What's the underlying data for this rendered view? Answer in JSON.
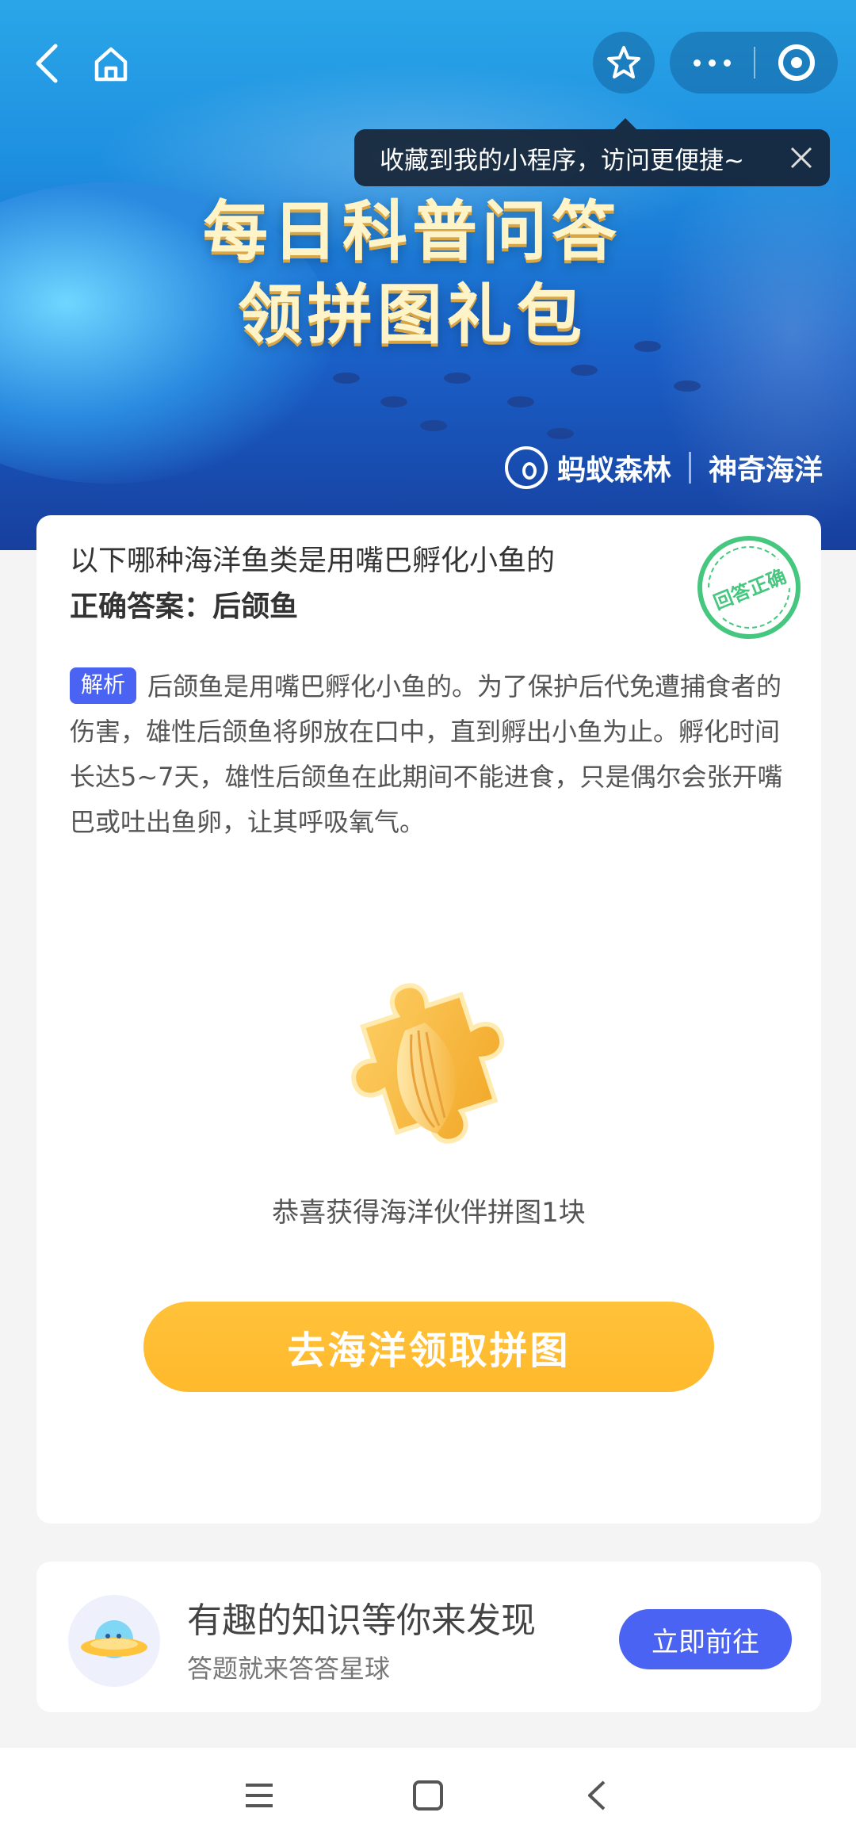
{
  "banner": {
    "title_line1": "每日科普问答",
    "title_line2": "领拼图礼包",
    "brand_left": "蚂蚁森林",
    "brand_right": "神奇海洋"
  },
  "nav": {
    "back_icon": "back-arrow-icon",
    "home_icon": "home-icon",
    "favorite_icon": "star-icon",
    "more_icon": "more-dots-icon",
    "close_icon": "target-icon"
  },
  "tooltip": {
    "text": "收藏到我的小程序，访问更便捷~",
    "close_icon": "close-icon"
  },
  "quiz": {
    "question": "以下哪种海洋鱼类是用嘴巴孵化小鱼的",
    "answer": "正确答案：后颌鱼",
    "stamp": "回答正确",
    "analysis_tag": "解析",
    "analysis_text": "后颌鱼是用嘴巴孵化小鱼的。为了保护后代免遭捕食者的伤害，雄性后颌鱼将卵放在口中，直到孵出小鱼为止。孵化时间长达5~7天，雄性后颌鱼在此期间不能进食，只是偶尔会张开嘴巴或吐出鱼卵，让其呼吸氧气。",
    "reward_text": "恭喜获得海洋伙伴拼图1块",
    "cta_label": "去海洋领取拼图"
  },
  "discover": {
    "title": "有趣的知识等你来发现",
    "subtitle": "答题就来答答星球",
    "button": "立即前往"
  },
  "colors": {
    "accent_blue": "#4b63f2",
    "cta_yellow": "#ffb92c",
    "stamp_green": "#45c77f"
  }
}
